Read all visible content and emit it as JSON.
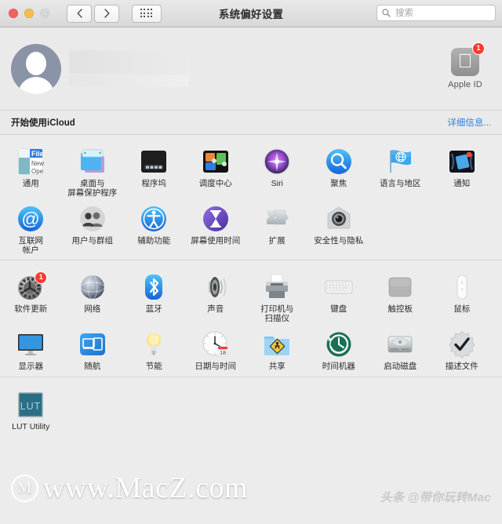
{
  "window": {
    "title": "系统偏好设置",
    "traffic_lights": [
      "close",
      "minimize",
      "zoom"
    ],
    "nav": {
      "back": "‹",
      "forward": "›",
      "grid": "grid-view"
    },
    "search": {
      "placeholder": "搜索",
      "value": ""
    }
  },
  "account": {
    "avatar": "default-user-avatar",
    "name_placeholder": "",
    "apple_id": {
      "label": "Apple ID",
      "badge": "1"
    }
  },
  "icloud": {
    "text": "开始使用iCloud",
    "link": "详细信息..."
  },
  "sections": [
    {
      "name": "personal",
      "items": [
        {
          "label": "通用",
          "icon": "general-icon"
        },
        {
          "label": "桌面与\n屏幕保护程序",
          "icon": "desktop-screensaver-icon"
        },
        {
          "label": "程序坞",
          "icon": "dock-icon"
        },
        {
          "label": "调度中心",
          "icon": "mission-control-icon"
        },
        {
          "label": "Siri",
          "icon": "siri-icon"
        },
        {
          "label": "聚焦",
          "icon": "spotlight-icon"
        },
        {
          "label": "语言与地区",
          "icon": "language-region-icon"
        },
        {
          "label": "通知",
          "icon": "notifications-icon"
        },
        {
          "label": "互联网\n帐户",
          "icon": "internet-accounts-icon"
        },
        {
          "label": "用户与群组",
          "icon": "users-groups-icon"
        },
        {
          "label": "辅助功能",
          "icon": "accessibility-icon"
        },
        {
          "label": "屏幕使用时间",
          "icon": "screen-time-icon"
        },
        {
          "label": "扩展",
          "icon": "extensions-icon"
        },
        {
          "label": "安全性与隐私",
          "icon": "security-privacy-icon"
        }
      ]
    },
    {
      "name": "hardware",
      "items": [
        {
          "label": "软件更新",
          "icon": "software-update-icon",
          "badge": "1"
        },
        {
          "label": "网络",
          "icon": "network-icon"
        },
        {
          "label": "蓝牙",
          "icon": "bluetooth-icon"
        },
        {
          "label": "声音",
          "icon": "sound-icon"
        },
        {
          "label": "打印机与\n扫描仪",
          "icon": "printers-scanners-icon"
        },
        {
          "label": "键盘",
          "icon": "keyboard-icon"
        },
        {
          "label": "触控板",
          "icon": "trackpad-icon"
        },
        {
          "label": "鼠标",
          "icon": "mouse-icon"
        },
        {
          "label": "显示器",
          "icon": "displays-icon"
        },
        {
          "label": "随航",
          "icon": "sidecar-icon"
        },
        {
          "label": "节能",
          "icon": "energy-saver-icon"
        },
        {
          "label": "日期与时间",
          "icon": "date-time-icon"
        },
        {
          "label": "共享",
          "icon": "sharing-icon"
        },
        {
          "label": "时间机器",
          "icon": "time-machine-icon"
        },
        {
          "label": "启动磁盘",
          "icon": "startup-disk-icon"
        },
        {
          "label": "描述文件",
          "icon": "profiles-icon"
        }
      ]
    },
    {
      "name": "third-party",
      "items": [
        {
          "label": "LUT Utility",
          "icon": "lut-utility-icon",
          "icon_text": "LUT"
        }
      ]
    }
  ],
  "watermarks": {
    "main": "www.MacZ.com",
    "main_mark": "M",
    "side": "头条 @带你玩转Mac"
  },
  "colors": {
    "accent_blue": "#2f7de1",
    "badge_red": "#fc3b30",
    "window_bg": "#ececec",
    "banner_bg": "#eaeaea"
  },
  "calendar_day": "18"
}
